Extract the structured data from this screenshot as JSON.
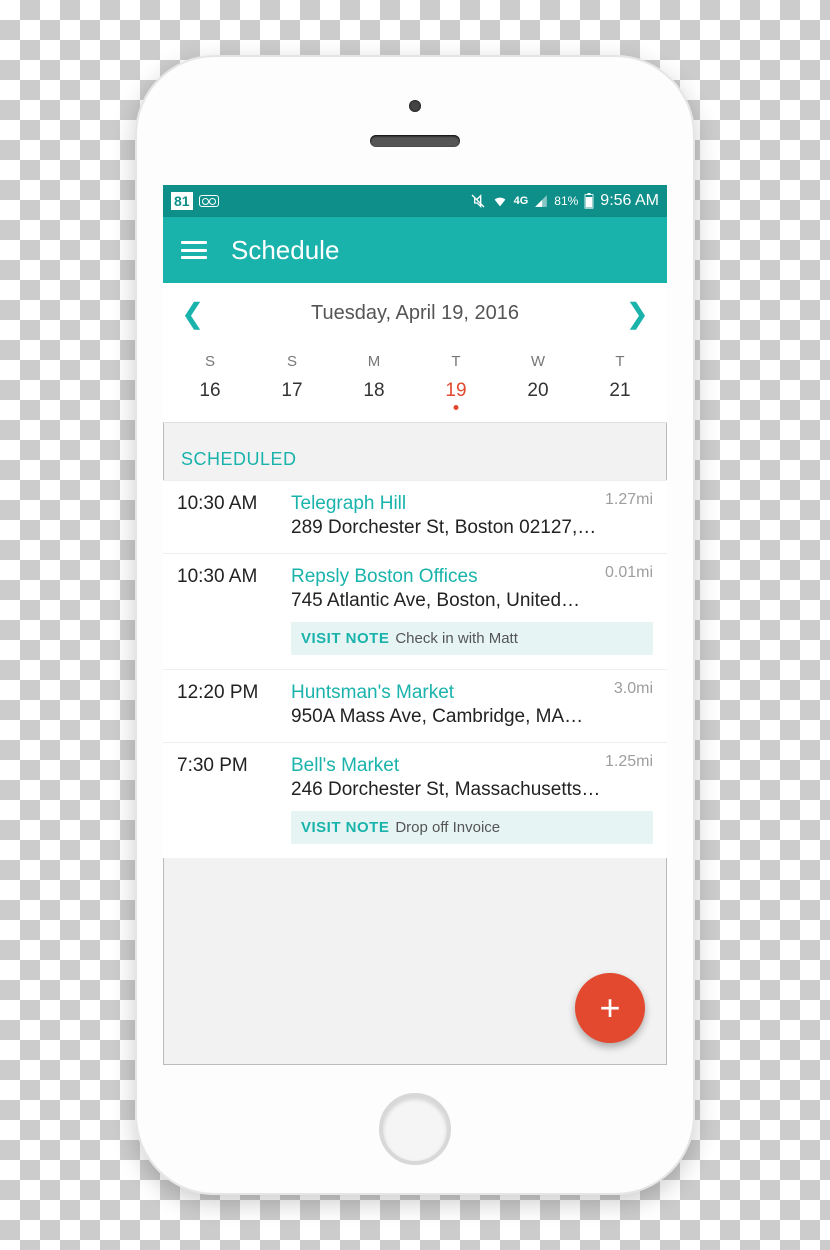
{
  "status": {
    "notif_badge": "81",
    "battery_pct": "81%",
    "time": "9:56 AM",
    "network": "4G"
  },
  "header": {
    "title": "Schedule"
  },
  "date_nav": {
    "label": "Tuesday, April 19, 2016"
  },
  "week": {
    "dows": [
      "S",
      "S",
      "M",
      "T",
      "W",
      "T"
    ],
    "nums": [
      "16",
      "17",
      "18",
      "19",
      "20",
      "21"
    ],
    "selected_index": 3
  },
  "section_label": "SCHEDULED",
  "note_prefix": "VISIT NOTE",
  "items": [
    {
      "time": "10:30 AM",
      "title": "Telegraph Hill",
      "addr": "289 Dorchester St, Boston 02127,…",
      "dist": "1.27mi",
      "note": null
    },
    {
      "time": "10:30 AM",
      "title": "Repsly Boston Offices",
      "addr": "745 Atlantic Ave, Boston, United…",
      "dist": "0.01mi",
      "note": "Check in with Matt"
    },
    {
      "time": "12:20 PM",
      "title": "Huntsman's Market",
      "addr": "950A Mass Ave, Cambridge, MA…",
      "dist": "3.0mi",
      "note": null
    },
    {
      "time": "7:30 PM",
      "title": "Bell's Market",
      "addr": "246 Dorchester St, Massachusetts…",
      "dist": "1.25mi",
      "note": "Drop off Invoice"
    }
  ],
  "fab": "+"
}
